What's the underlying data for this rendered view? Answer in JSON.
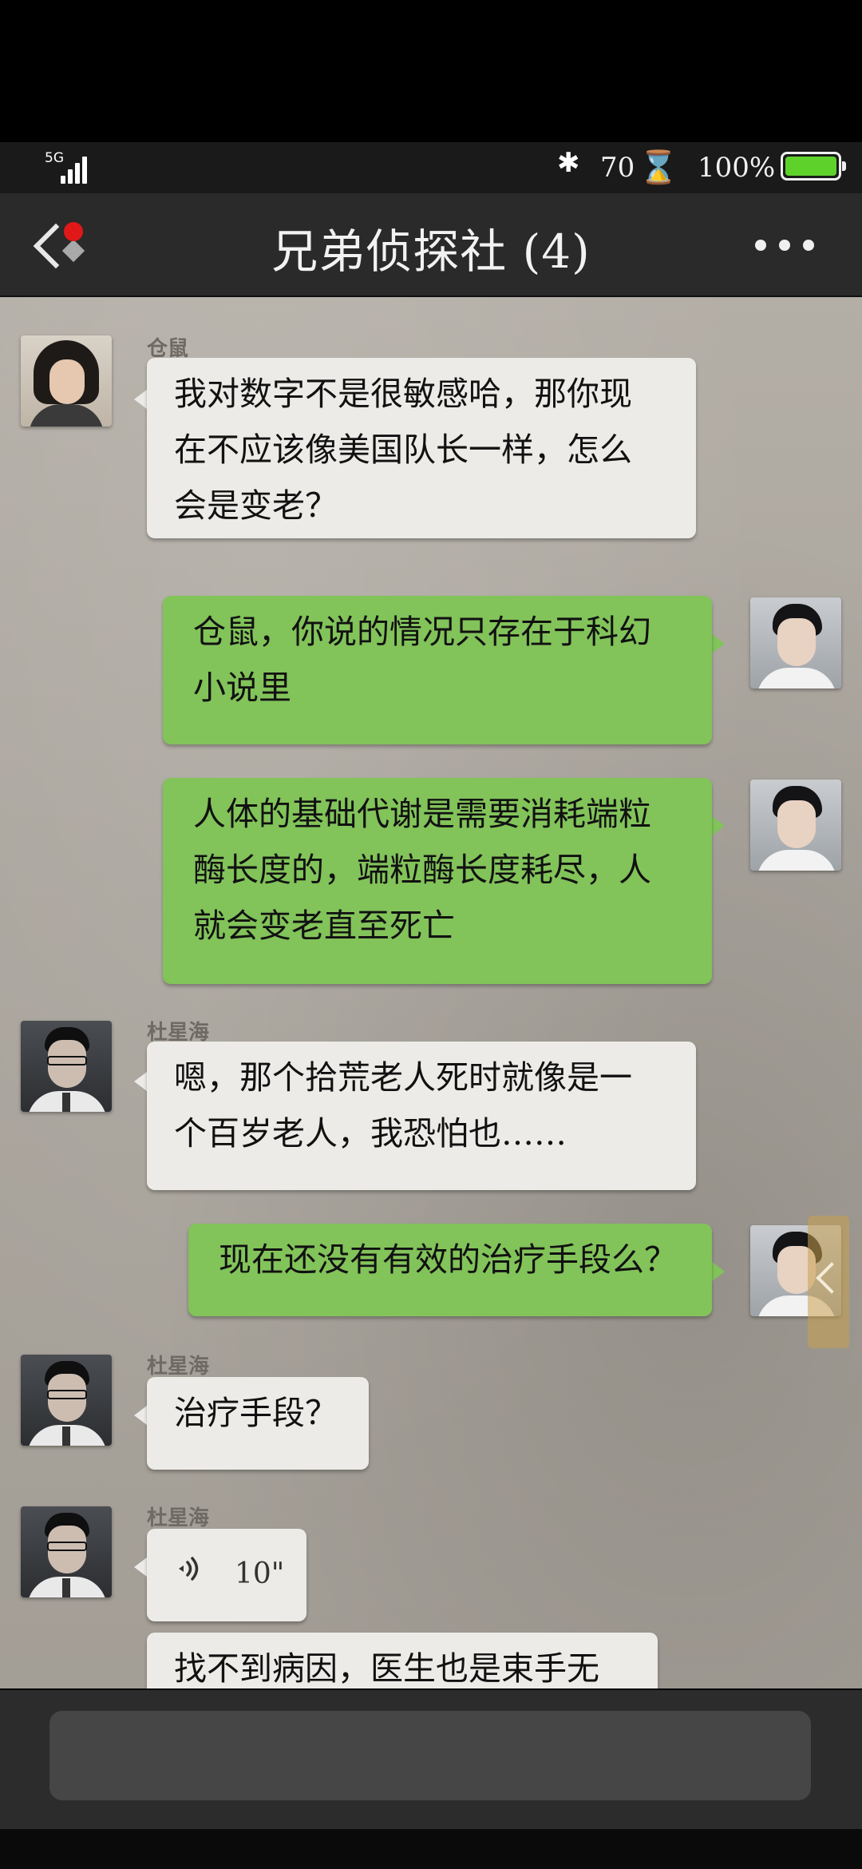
{
  "status_bar": {
    "network": "5G",
    "bluetooth_icon": "bluetooth-icon",
    "counter": "70",
    "hourglass_icon": "hourglass-icon",
    "battery_percent": "100%",
    "battery_icon": "battery-icon",
    "battery_color": "#5fd12b"
  },
  "header": {
    "back_icon": "back-chevron-icon",
    "title": "兄弟侦探社 (4)",
    "more_icon": "more-dots-icon"
  },
  "messages": [
    {
      "side": "in",
      "sender": "仓鼠",
      "avatar": "female-avatar",
      "lines": [
        "我对数字不是很敏感哈，那你现",
        "在不应该像美国队长一样，怎么",
        "会是变老？"
      ]
    },
    {
      "side": "out",
      "avatar": "player-avatar",
      "lines": [
        "仓鼠，你说的情况只存在于科幻",
        "小说里"
      ]
    },
    {
      "side": "out",
      "avatar": "player-avatar",
      "lines": [
        "人体的基础代谢是需要消耗端粒",
        "酶长度的，端粒酶长度耗尽，人",
        "就会变老直至死亡"
      ]
    },
    {
      "side": "in",
      "sender": "杜星海",
      "avatar": "du-xinghai-avatar",
      "lines": [
        "嗯，那个拾荒老人死时就像是一",
        "个百岁老人，我恐怕也……"
      ]
    },
    {
      "side": "out",
      "avatar": "player-avatar",
      "lines": [
        "现在还没有有效的治疗手段么？"
      ]
    },
    {
      "side": "in",
      "sender": "杜星海",
      "avatar": "du-xinghai-avatar",
      "lines": [
        "治疗手段？"
      ]
    },
    {
      "side": "in",
      "sender": "杜星海",
      "avatar": "du-xinghai-avatar",
      "voice_duration": "10\"",
      "voice_icon": "voice-wave-icon"
    },
    {
      "side": "in",
      "partial": true,
      "lines": [
        "找不到病因，医生也是束手无策"
      ]
    }
  ],
  "side_tab_icon": "chevron-left-icon",
  "colors": {
    "incoming_bubble": "#ecebe8",
    "outgoing_bubble": "#82c35a",
    "header": "#2a2a2a"
  }
}
